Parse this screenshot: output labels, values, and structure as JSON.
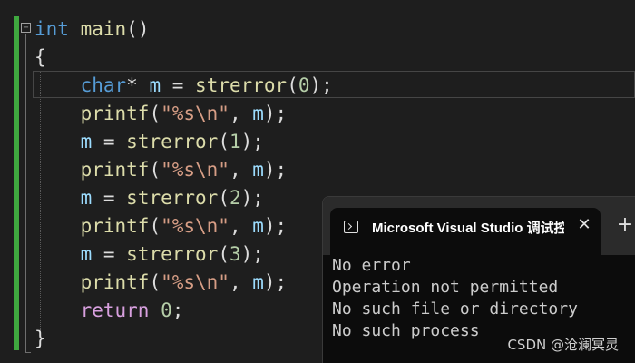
{
  "editor": {
    "fold_glyph": "−",
    "code_lines": [
      {
        "tokens": [
          {
            "text": "int",
            "cls": "kw"
          },
          {
            "text": " ",
            "cls": "punc"
          },
          {
            "text": "main",
            "cls": "fn"
          },
          {
            "text": "()",
            "cls": "punc"
          }
        ]
      },
      {
        "tokens": [
          {
            "text": "{",
            "cls": "punc"
          }
        ]
      },
      {
        "tokens": [
          {
            "text": "    ",
            "cls": "punc"
          },
          {
            "text": "char",
            "cls": "kw"
          },
          {
            "text": "* ",
            "cls": "punc"
          },
          {
            "text": "m",
            "cls": "var"
          },
          {
            "text": " = ",
            "cls": "punc"
          },
          {
            "text": "strerror",
            "cls": "fn"
          },
          {
            "text": "(",
            "cls": "punc"
          },
          {
            "text": "0",
            "cls": "num"
          },
          {
            "text": ");",
            "cls": "punc"
          }
        ]
      },
      {
        "tokens": [
          {
            "text": "    ",
            "cls": "punc"
          },
          {
            "text": "printf",
            "cls": "fn"
          },
          {
            "text": "(",
            "cls": "punc"
          },
          {
            "text": "\"%s\\n\"",
            "cls": "str"
          },
          {
            "text": ", ",
            "cls": "punc"
          },
          {
            "text": "m",
            "cls": "var"
          },
          {
            "text": ");",
            "cls": "punc"
          }
        ]
      },
      {
        "tokens": [
          {
            "text": "    ",
            "cls": "punc"
          },
          {
            "text": "m",
            "cls": "var"
          },
          {
            "text": " = ",
            "cls": "punc"
          },
          {
            "text": "strerror",
            "cls": "fn"
          },
          {
            "text": "(",
            "cls": "punc"
          },
          {
            "text": "1",
            "cls": "num"
          },
          {
            "text": ");",
            "cls": "punc"
          }
        ]
      },
      {
        "tokens": [
          {
            "text": "    ",
            "cls": "punc"
          },
          {
            "text": "printf",
            "cls": "fn"
          },
          {
            "text": "(",
            "cls": "punc"
          },
          {
            "text": "\"%s\\n\"",
            "cls": "str"
          },
          {
            "text": ", ",
            "cls": "punc"
          },
          {
            "text": "m",
            "cls": "var"
          },
          {
            "text": ");",
            "cls": "punc"
          }
        ]
      },
      {
        "tokens": [
          {
            "text": "    ",
            "cls": "punc"
          },
          {
            "text": "m",
            "cls": "var"
          },
          {
            "text": " = ",
            "cls": "punc"
          },
          {
            "text": "strerror",
            "cls": "fn"
          },
          {
            "text": "(",
            "cls": "punc"
          },
          {
            "text": "2",
            "cls": "num"
          },
          {
            "text": ");",
            "cls": "punc"
          }
        ]
      },
      {
        "tokens": [
          {
            "text": "    ",
            "cls": "punc"
          },
          {
            "text": "printf",
            "cls": "fn"
          },
          {
            "text": "(",
            "cls": "punc"
          },
          {
            "text": "\"%s\\n\"",
            "cls": "str"
          },
          {
            "text": ", ",
            "cls": "punc"
          },
          {
            "text": "m",
            "cls": "var"
          },
          {
            "text": ");",
            "cls": "punc"
          }
        ]
      },
      {
        "tokens": [
          {
            "text": "    ",
            "cls": "punc"
          },
          {
            "text": "m",
            "cls": "var"
          },
          {
            "text": " = ",
            "cls": "punc"
          },
          {
            "text": "strerror",
            "cls": "fn"
          },
          {
            "text": "(",
            "cls": "punc"
          },
          {
            "text": "3",
            "cls": "num"
          },
          {
            "text": ");",
            "cls": "punc"
          }
        ]
      },
      {
        "tokens": [
          {
            "text": "    ",
            "cls": "punc"
          },
          {
            "text": "printf",
            "cls": "fn"
          },
          {
            "text": "(",
            "cls": "punc"
          },
          {
            "text": "\"%s\\n\"",
            "cls": "str"
          },
          {
            "text": ", ",
            "cls": "punc"
          },
          {
            "text": "m",
            "cls": "var"
          },
          {
            "text": ");",
            "cls": "punc"
          }
        ]
      },
      {
        "tokens": [
          {
            "text": "    ",
            "cls": "punc"
          },
          {
            "text": "return",
            "cls": "ctl"
          },
          {
            "text": " ",
            "cls": "punc"
          },
          {
            "text": "0",
            "cls": "num"
          },
          {
            "text": ";",
            "cls": "punc"
          }
        ]
      },
      {
        "tokens": [
          {
            "text": "}",
            "cls": "punc"
          }
        ]
      }
    ]
  },
  "console": {
    "tab_title": "Microsoft Visual Studio 调试控制台",
    "close_glyph": "✕",
    "new_tab_glyph": "+",
    "output_lines": [
      "No error",
      "Operation not permitted",
      "No such file or directory",
      "No such process"
    ]
  },
  "watermark": "CSDN @沧澜冥灵",
  "colors": {
    "editor_bg": "#1e1e1e",
    "change_bar": "#3fa83f",
    "keyword": "#569cd6",
    "function": "#dcdcaa",
    "variable": "#9cdcfe",
    "string": "#d69d85",
    "number": "#b5cea8",
    "control": "#d8a0df",
    "console_bg": "#0c0c0c"
  }
}
